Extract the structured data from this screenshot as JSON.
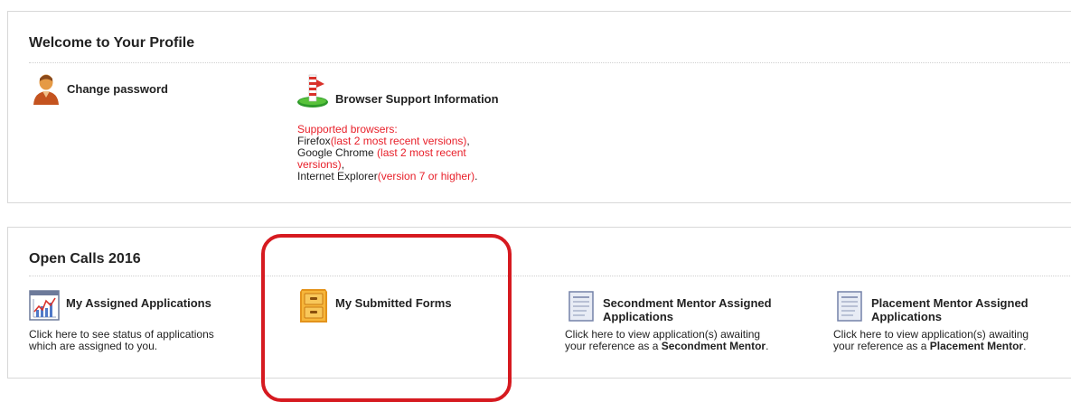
{
  "profile": {
    "title": "Welcome to Your Profile",
    "change_password": {
      "label": "Change password",
      "icon": "user-icon"
    },
    "browser_support": {
      "label": "Browser Support Information",
      "icon": "browser-support-icon",
      "intro": "Supported browsers:",
      "firefox_name": "Firefox",
      "firefox_note": "(last 2 most recent versions)",
      "chrome_name": "Google Chrome ",
      "chrome_note_1": "(last 2 most recent",
      "chrome_note_2": "versions)",
      "ie_name": "Internet Explorer",
      "ie_note": "(version 7 or higher)",
      "comma": ",",
      "period": "."
    }
  },
  "open_calls": {
    "title": "Open Calls 2016",
    "assigned": {
      "label": "My Assigned Applications",
      "icon": "chart-icon",
      "desc_1": "Click here to see status of applications",
      "desc_2": "which are assigned to you."
    },
    "submitted": {
      "label": "My Submitted Forms",
      "icon": "file-cabinet-icon"
    },
    "secondment": {
      "label_1": "Secondment Mentor Assigned",
      "label_2": "Applications",
      "icon": "document-icon",
      "desc_1": "Click here to view application(s) awaiting",
      "desc_2": "your reference as a ",
      "role": "Secondment Mentor",
      "period": "."
    },
    "placement": {
      "label_1": "Placement Mentor Assigned",
      "label_2": "Applications",
      "icon": "document-icon",
      "desc_1": "Click here to view application(s) awaiting",
      "desc_2": "your reference as a ",
      "role": "Placement Mentor",
      "period": "."
    }
  },
  "colors": {
    "accent_red": "#e8202a",
    "highlight_red": "#d61a20",
    "border": "#d8d8d8"
  }
}
